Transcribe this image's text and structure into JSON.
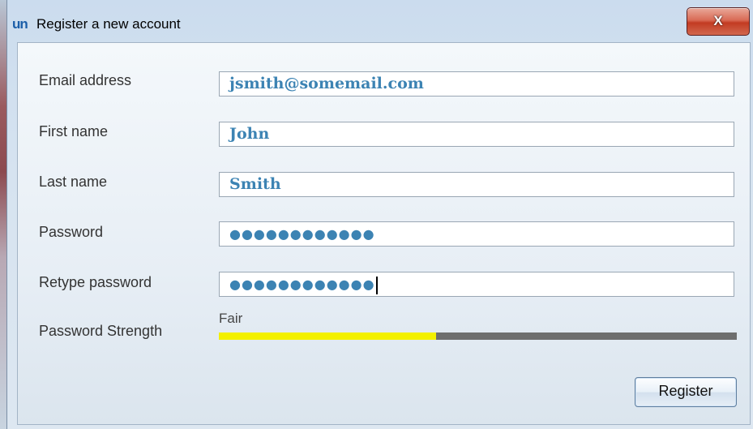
{
  "window": {
    "title": "Register a new account",
    "logo_text": "un",
    "close_glyph": "X"
  },
  "form": {
    "email": {
      "label": "Email address",
      "value": "jsmith@somemail.com"
    },
    "first_name": {
      "label": "First name",
      "value": "John"
    },
    "last_name": {
      "label": "Last name",
      "value": "Smith"
    },
    "password": {
      "label": "Password",
      "value": "●●●●●●●●●●●●"
    },
    "retype_password": {
      "label": "Retype password",
      "value": "●●●●●●●●●●●●"
    },
    "strength": {
      "label": "Password Strength",
      "value": "Fair",
      "level": 0.42,
      "fill_color": "#f3f000",
      "track_color": "#6e6e6e"
    },
    "register_label": "Register"
  },
  "colors": {
    "field_text": "#3c83b3",
    "close_button": "#c23b22"
  }
}
